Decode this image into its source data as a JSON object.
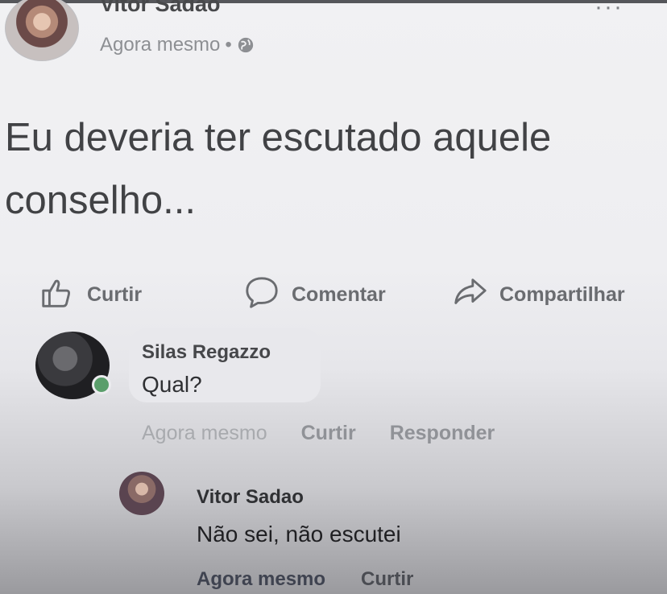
{
  "post": {
    "author": "Vitor Sadao",
    "time": "Agora mesmo",
    "separator": "•",
    "privacy_icon": "globe-icon",
    "more_icon": "more-dots-icon",
    "text": "Eu deveria ter escutado aquele conselho..."
  },
  "actions": {
    "like_label": "Curtir",
    "comment_label": "Comentar",
    "share_label": "Compartilhar"
  },
  "comments": [
    {
      "author": "Silas Regazzo",
      "text": "Qual?",
      "time": "Agora mesmo",
      "like_label": "Curtir",
      "reply_label": "Responder",
      "online": true
    },
    {
      "author": "Vitor Sadao",
      "text": "Não sei, não escutei",
      "time": "Agora mesmo",
      "like_label": "Curtir"
    }
  ],
  "colors": {
    "online": "#5a9e6b",
    "text": "#3a3b3d"
  }
}
